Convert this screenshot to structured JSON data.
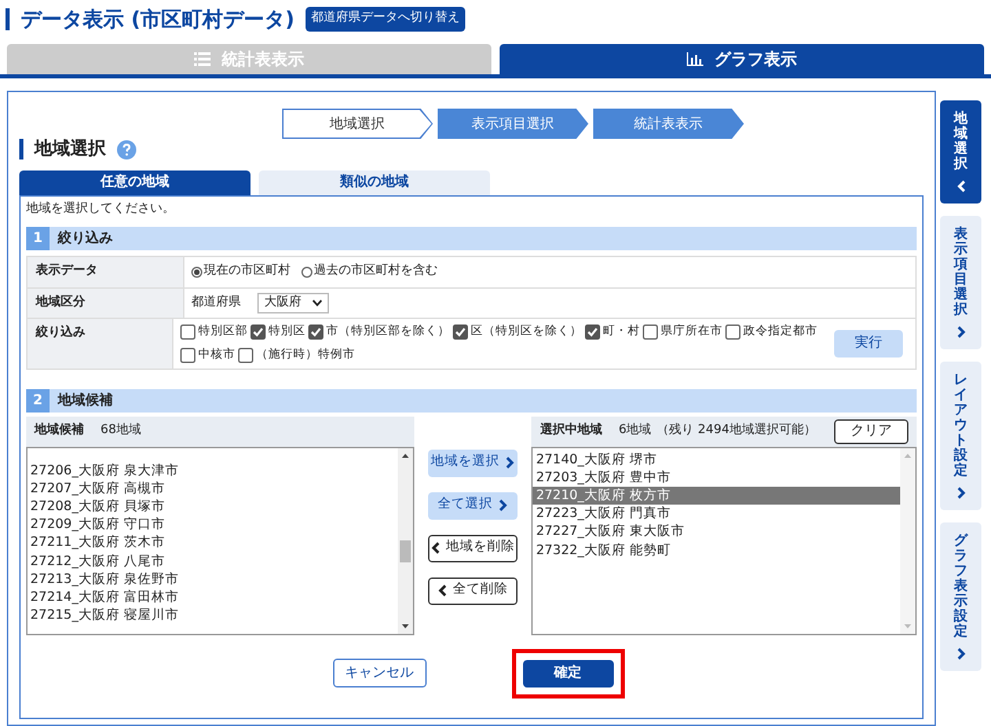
{
  "title": "データ表示 (市区町村データ)",
  "switch_button": "都道府県データへ切り替え",
  "view_tabs": [
    {
      "label": "統計表表示",
      "kind": "table",
      "selected": false
    },
    {
      "label": "グラフ表示",
      "kind": "chart",
      "selected": true
    }
  ],
  "steps": [
    {
      "label": "地域選択",
      "selected": false
    },
    {
      "label": "表示項目選択",
      "selected": true
    },
    {
      "label": "統計表表示",
      "selected": true
    }
  ],
  "section_title": "地域選択",
  "region_tabs": [
    {
      "label": "任意の地域",
      "selected": true
    },
    {
      "label": "類似の地域",
      "selected": false
    }
  ],
  "instruction": "地域を選択してください。",
  "filter": {
    "number": "1",
    "title": "絞り込み",
    "display_data": {
      "label": "表示データ",
      "options": [
        {
          "label": "現在の市区町村",
          "selected": true
        },
        {
          "label": "過去の市区町村を含む",
          "selected": false
        }
      ]
    },
    "region_type": {
      "label": "地域区分",
      "field_label": "都道府県",
      "value": "大阪府"
    },
    "narrowing": {
      "label": "絞り込み",
      "button": "実行",
      "options": [
        {
          "label": "特別区部",
          "checked": false
        },
        {
          "label": "特別区",
          "checked": true
        },
        {
          "label": "市（特別区部を除く）",
          "checked": true
        },
        {
          "label": "区（特別区を除く）",
          "checked": true
        },
        {
          "label": "町・村",
          "checked": true
        },
        {
          "label": "県庁所在市",
          "checked": false
        },
        {
          "label": "政令指定都市",
          "checked": false
        },
        {
          "label": "中核市",
          "checked": false
        },
        {
          "label": "（施行時）特例市",
          "checked": false
        }
      ]
    }
  },
  "candidates": {
    "number": "2",
    "title": "地域候補",
    "list_title": "地域候補",
    "count": "68地域",
    "items": [
      "27206_大阪府 泉大津市",
      "27207_大阪府 高槻市",
      "27208_大阪府 貝塚市",
      "27209_大阪府 守口市",
      "27211_大阪府 茨木市",
      "27212_大阪府 八尾市",
      "27213_大阪府 泉佐野市",
      "27214_大阪府 富田林市",
      "27215_大阪府 寝屋川市"
    ]
  },
  "transfer_buttons": [
    {
      "label": "地域を選択",
      "kind": "add"
    },
    {
      "label": "全て選択",
      "kind": "add"
    },
    {
      "label": "地域を削除",
      "kind": "remove"
    },
    {
      "label": "全て削除",
      "kind": "remove"
    }
  ],
  "selected_regions": {
    "title": "選択中地域",
    "count": "6地域",
    "remaining": "（残り 2494地域選択可能）",
    "clear": "クリア",
    "items": [
      {
        "label": "27140_大阪府 堺市",
        "selected": false
      },
      {
        "label": "27203_大阪府 豊中市",
        "selected": false
      },
      {
        "label": "27210_大阪府 枚方市",
        "selected": true
      },
      {
        "label": "27223_大阪府 門真市",
        "selected": false
      },
      {
        "label": "27227_大阪府 東大阪市",
        "selected": false
      },
      {
        "label": "27322_大阪府 能勢町",
        "selected": false
      }
    ]
  },
  "footer": {
    "cancel": "キャンセル",
    "confirm": "確定",
    "confirm_highlighted": true
  },
  "side_tabs": [
    {
      "label": "地域選択",
      "selected": true
    },
    {
      "label": "表示項目選択",
      "selected": false
    },
    {
      "label": "レイアウト設定",
      "selected": false
    },
    {
      "label": "グラフ表示設定",
      "selected": false
    }
  ]
}
